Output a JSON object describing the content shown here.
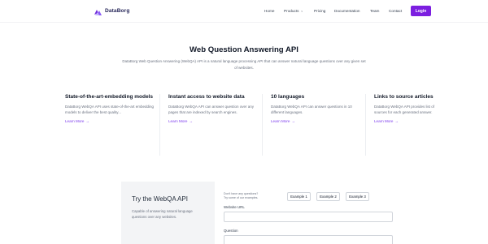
{
  "header": {
    "logo_text": "DataBorg",
    "nav": [
      {
        "label": "Home"
      },
      {
        "label": "Products",
        "chevron": "chevron-down-icon"
      },
      {
        "label": "Pricing"
      },
      {
        "label": "Documentation"
      },
      {
        "label": "Team"
      },
      {
        "label": "Contact"
      }
    ],
    "login_label": "Login"
  },
  "hero": {
    "title": "Web Question Answering API",
    "subtitle": "DataBorg Web Question Answering (WebQA) API is a natural language processing API that can answer natural language questions over any given set of websites."
  },
  "features": [
    {
      "title": "State-of-the-art-embedding models",
      "desc": "DataBorg WebQA API uses state-of-the-art embedding models to deliver the best quality...",
      "link": "Learn More"
    },
    {
      "title": "Instant access to website data",
      "desc": "DataBorg WebQA API can answer question over any pages that are indexed by search engines.",
      "link": "Learn More"
    },
    {
      "title": "10 languages",
      "desc": "DataBorg WebQA API can answer questions in 10 different languages.",
      "link": "Learn More"
    },
    {
      "title": "Links to source articles",
      "desc": "DataBorg WebQA API provides list of sources for each generated answer.",
      "link": "Learn More"
    }
  ],
  "try": {
    "title": "Try the WebQA API",
    "desc": "Capable of answering natural language questions over any websites.",
    "hint_line1": "Don't have any questions?",
    "hint_line2": "Try some of our examples.",
    "examples": [
      "Example 1",
      "Example 2",
      "Example 3"
    ],
    "website_label": "Website URL",
    "website_value": "",
    "question_label": "Question",
    "question_value": ""
  },
  "colors": {
    "accent": "#7c1fe0",
    "link": "#7c3aed",
    "panel": "#f3f4f6"
  }
}
